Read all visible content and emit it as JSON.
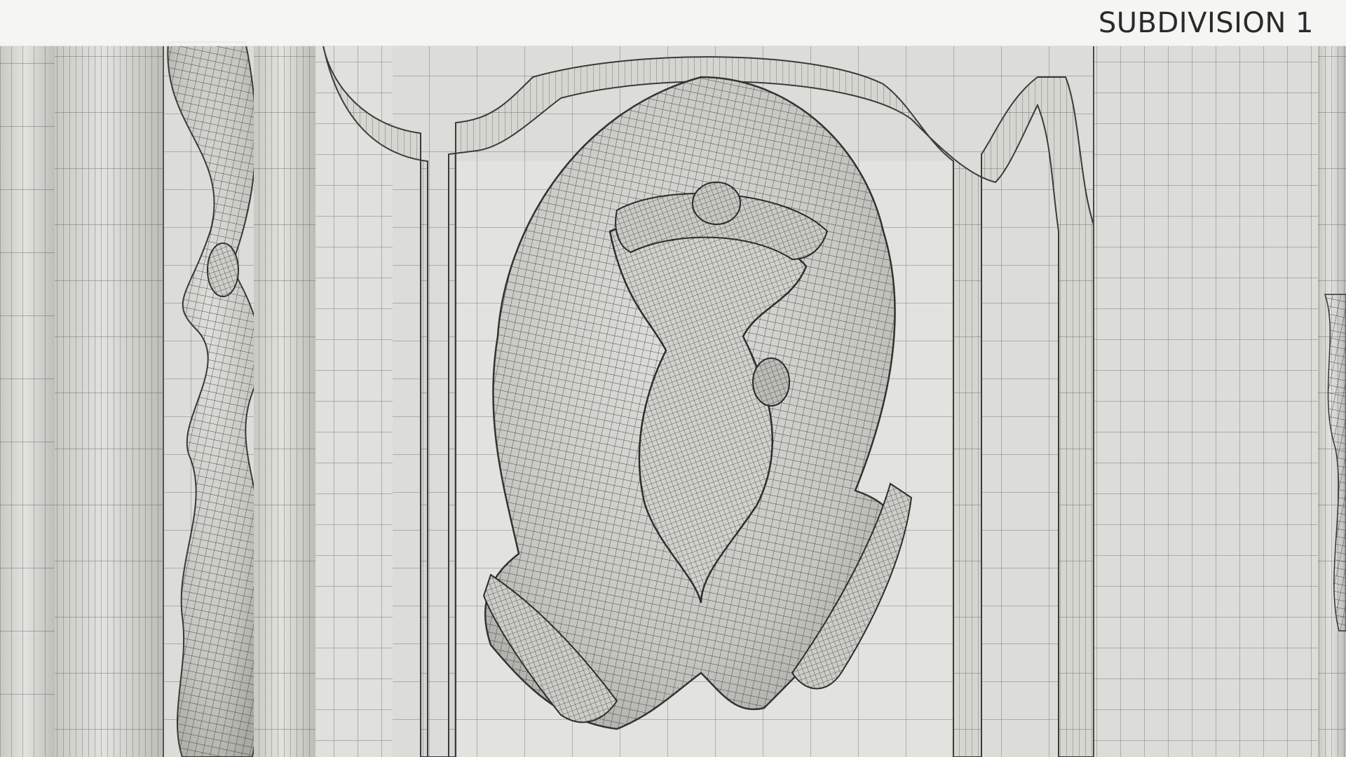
{
  "header": {
    "title": "SUBDIVISION 1"
  },
  "scene": {
    "kind": "wireframe-render",
    "subject": "carved-relief-panel",
    "colors": {
      "surface": "#dcdcd8",
      "wire": "#2b2b2b",
      "shadow": "#9e9e98",
      "header_bg": "#f6f6f4",
      "title_text": "#2a2a2a"
    }
  }
}
